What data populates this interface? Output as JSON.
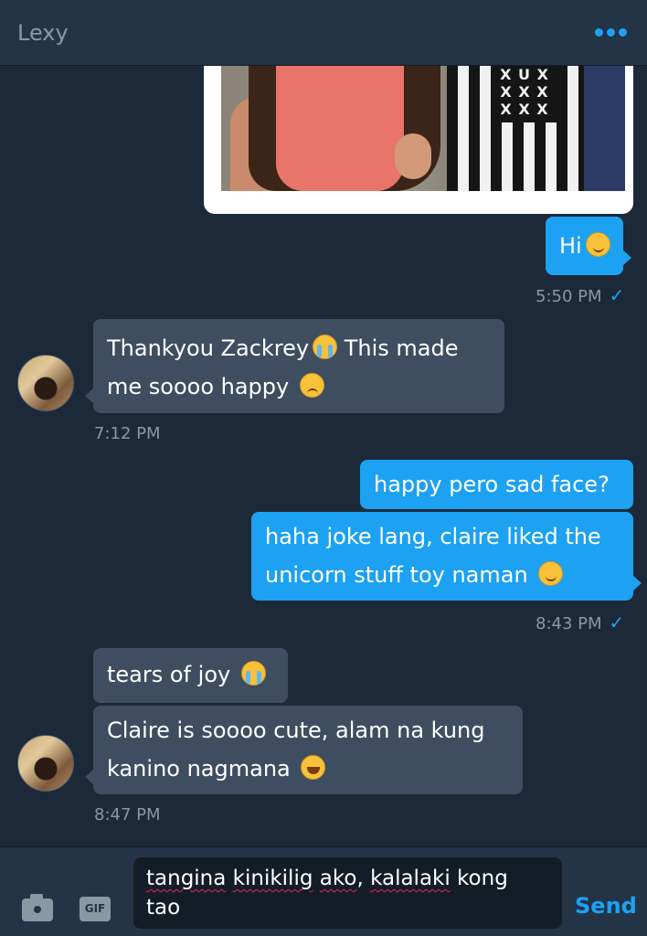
{
  "header": {
    "title": "Lexy",
    "menu_icon": "more-horizontal-icon"
  },
  "messages": [
    {
      "direction": "outgoing",
      "type": "image",
      "image_description": "shared photo"
    },
    {
      "direction": "outgoing",
      "text": "Hi",
      "emoji": "smile"
    },
    {
      "direction": "outgoing",
      "type": "timestamp",
      "time": "5:50 PM",
      "read": true
    },
    {
      "direction": "incoming",
      "lines": [
        "Thankyou Zackrey",
        "This made",
        "me soooo happy"
      ],
      "emojis": [
        "cry",
        "sad"
      ]
    },
    {
      "direction": "incoming",
      "type": "timestamp",
      "time": "7:12 PM"
    },
    {
      "direction": "outgoing",
      "text": "happy pero sad face?"
    },
    {
      "direction": "outgoing",
      "lines": [
        "haha joke lang, claire liked the",
        "unicorn stuff toy naman"
      ],
      "emoji": "smile"
    },
    {
      "direction": "outgoing",
      "type": "timestamp",
      "time": "8:43 PM",
      "read": true
    },
    {
      "direction": "incoming",
      "text": "tears of joy",
      "emoji": "cry"
    },
    {
      "direction": "incoming",
      "lines": [
        "Claire is soooo cute, alam na kung",
        "kanino nagmana"
      ],
      "emoji": "laugh"
    },
    {
      "direction": "incoming",
      "type": "timestamp",
      "time": "8:47 PM"
    }
  ],
  "photo_shirt_text": [
    "X U X",
    "X X X",
    "X X X"
  ],
  "composer": {
    "draft_parts": [
      "tangina",
      " ",
      "kinikilig",
      " ",
      "ako",
      ", ",
      "kalalaki",
      " kong\ntao"
    ],
    "send_label": "Send",
    "gif_label": "GIF"
  },
  "colors": {
    "accent": "#1da1f2",
    "background": "#1c2938",
    "incoming_bubble": "#3e4e60",
    "header": "#243447"
  }
}
